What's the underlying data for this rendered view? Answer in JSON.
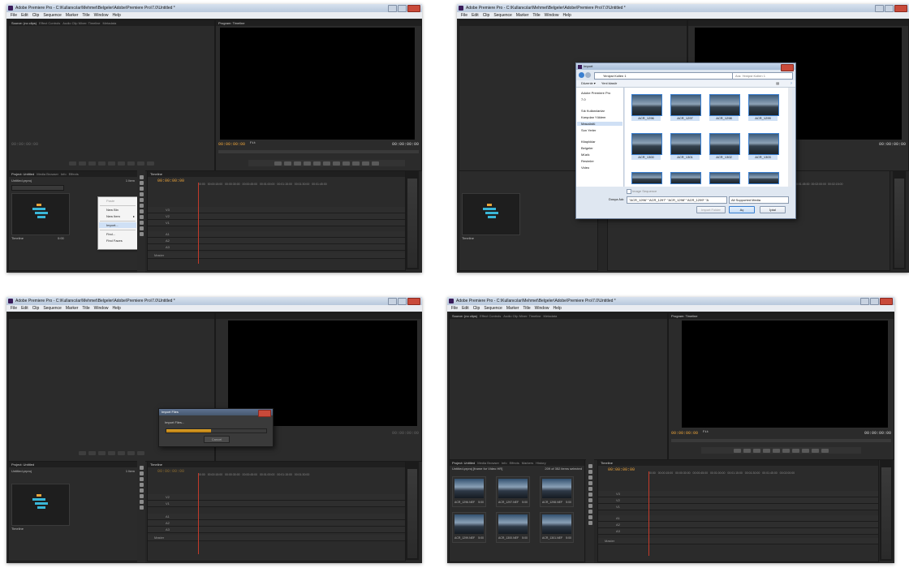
{
  "app": {
    "title": "Adobe Premiere Pro - C:\\Kullanıcılar\\Mehmet\\Belgeler\\Adobe\\Premiere Pro\\7.0\\Untitled *",
    "menu": [
      "File",
      "Edit",
      "Clip",
      "Sequence",
      "Marker",
      "Title",
      "Window",
      "Help"
    ]
  },
  "panels": {
    "source_tabs": [
      "Source: (no clips)",
      "Effect Controls",
      "Audio Clip Mixer: Timeline",
      "Metadata"
    ],
    "program_tab": "Program: Timeline",
    "timecode_main": "00:00:00:00",
    "timecode_zero": "00:00:00:00",
    "fit_label": "Fit",
    "project_tabs": [
      "Project: Untitled",
      "Media Browser",
      "Info",
      "Effects",
      "Markers",
      "History"
    ],
    "project_file": "Untitled.prproj",
    "item_count": "1 Item",
    "seq_name": "Timeline",
    "seq_duration": "0:00",
    "timeline_tab": "Timeline",
    "tracks": [
      "V3",
      "V2",
      "V1",
      "A1",
      "A2",
      "A3",
      "Master"
    ],
    "ruler": [
      "00:00",
      "00:00:15:00",
      "00:00:30:00",
      "00:00:45:00",
      "00:01:00:00",
      "00:01:15:00",
      "00:01:30:00",
      "00:01:45:00",
      "00:02:00:00",
      "00:02:15:00"
    ]
  },
  "context_menu": {
    "items": [
      "Paste",
      "New Bin",
      "New Item",
      "Import...",
      "Find...",
      "Find Faces"
    ]
  },
  "import_dialog": {
    "title": "Import",
    "path": "Yenipst Kollen 1",
    "search_placeholder": "Ara: Yenipst Kollen 1",
    "organize": "Düzenle ▾",
    "new_folder": "Yeni klasör",
    "nav": [
      "Adobe Premiere Pro",
      "7.0",
      "Sık Kullanılanlar",
      "Karşıdan Yüklem",
      "Masaüstü",
      "Son Yerler",
      "Kitaplıklar",
      "Belgeler",
      "Müzik",
      "Resimler",
      "Video"
    ],
    "files": [
      "ACR_1296",
      "ACR_1297",
      "ACR_1298",
      "ACR_1299",
      "ACR_1300",
      "ACR_1301",
      "ACR_1302",
      "ACR_1303"
    ],
    "image_sequence": "Image Sequence",
    "filename_label": "Dosya Adı:",
    "filename_value": "\"ACR_1296\" \"ACR_1297\" \"ACR_1298\" \"ACR_1299\" \"A",
    "filetype": "All Supported Media",
    "import_folder": "Import Folder",
    "open_btn": "Aç",
    "cancel_btn": "İptal"
  },
  "progress_dialog": {
    "title": "Import Files",
    "label": "Import Files...",
    "cancel": "Cancel",
    "progress": 0.45
  },
  "final_state": {
    "project_info": "Untitled.prproj [frame for Video HR]",
    "selection_count": "209 of 352 items selected",
    "clips": [
      "ACR_1296.NEF",
      "ACR_1297.NEF",
      "ACR_1298.NEF",
      "ACR_1299.NEF",
      "ACR_1300.NEF",
      "ACR_1301.NEF"
    ],
    "clip_duration": "5:00"
  }
}
